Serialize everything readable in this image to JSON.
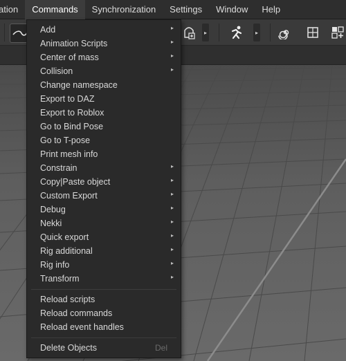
{
  "menubar": {
    "items": [
      "ation",
      "Commands",
      "Synchronization",
      "Settings",
      "Window",
      "Help"
    ],
    "active": "Commands"
  },
  "toolbar": {
    "icons": [
      "curve-icon",
      "add-transform-icon",
      "run-figure-icon",
      "spiral-icon",
      "target-frame-icon",
      "grid-add-icon"
    ]
  },
  "commands_menu": {
    "group1": [
      {
        "label": "Add",
        "submenu": true
      },
      {
        "label": "Animation Scripts",
        "submenu": true
      },
      {
        "label": "Center of mass",
        "submenu": true
      },
      {
        "label": "Collision",
        "submenu": true
      },
      {
        "label": "Change namespace",
        "submenu": false
      },
      {
        "label": "Export to DAZ",
        "submenu": false
      },
      {
        "label": "Export to Roblox",
        "submenu": false
      },
      {
        "label": "Go to Bind Pose",
        "submenu": false
      },
      {
        "label": "Go to T-pose",
        "submenu": false
      },
      {
        "label": "Print mesh info",
        "submenu": false
      },
      {
        "label": "Constrain",
        "submenu": true
      },
      {
        "label": "Copy|Paste object",
        "submenu": true
      },
      {
        "label": "Custom Export",
        "submenu": true
      },
      {
        "label": "Debug",
        "submenu": true
      },
      {
        "label": "Nekki",
        "submenu": true
      },
      {
        "label": "Quick export",
        "submenu": true
      },
      {
        "label": "Rig additional",
        "submenu": true
      },
      {
        "label": "Rig info",
        "submenu": true
      },
      {
        "label": "Transform",
        "submenu": true
      }
    ],
    "group2": [
      {
        "label": "Reload scripts"
      },
      {
        "label": "Reload commands"
      },
      {
        "label": "Reload event handles"
      }
    ],
    "group3": [
      {
        "label": "Delete Objects",
        "shortcut": "Del"
      }
    ]
  }
}
